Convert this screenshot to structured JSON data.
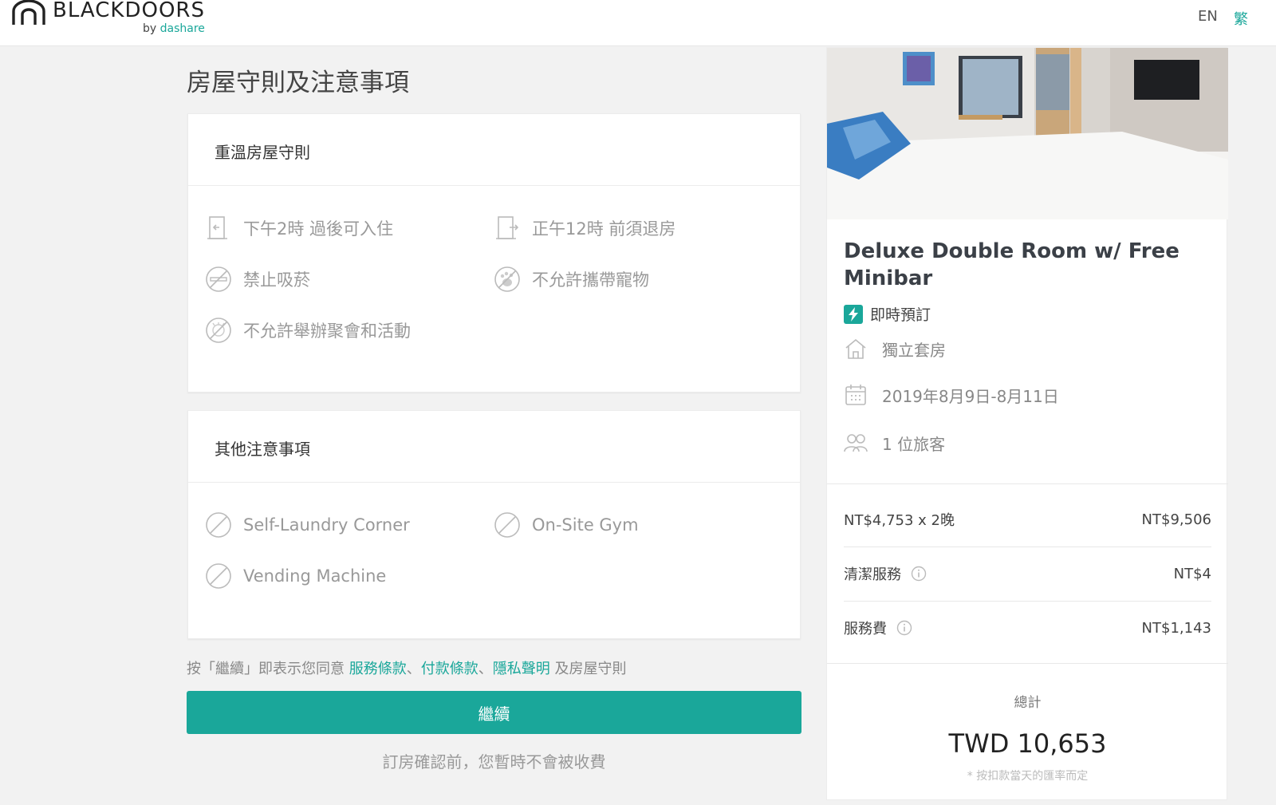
{
  "header": {
    "brand": "BLACKDOORS",
    "sub_by": "by ",
    "sub_brand": "dashare",
    "lang_en": "EN",
    "lang_zh": "繁"
  },
  "main": {
    "title": "房屋守則及注意事項",
    "rules_card": {
      "heading": "重溫房屋守則",
      "items": [
        "下午2時 過後可入住",
        "正午12時 前須退房",
        "禁止吸菸",
        "不允許攜帶寵物",
        "不允許舉辦聚會和活動"
      ]
    },
    "others_card": {
      "heading": "其他注意事項",
      "items": [
        "Self-Laundry Corner",
        "On-Site Gym",
        "Vending Machine"
      ]
    },
    "terms": {
      "prefix": "按「繼續」即表示您同意 ",
      "link_service": "服務條款",
      "sep1": "、",
      "link_payment": "付款條款",
      "sep2": "、",
      "link_privacy": "隱私聲明",
      "suffix": " 及房屋守則"
    },
    "continue_label": "繼續",
    "note": "訂房確認前，您暫時不會被收費"
  },
  "summary": {
    "room_title": "Deluxe Double Room w/ Free Minibar",
    "instant_booking": "即時預訂",
    "room_type": "獨立套房",
    "dates": "2019年8月9日-8月11日",
    "guests": "1 位旅客",
    "price_rows": [
      {
        "label": "NT$4,753 x 2晚",
        "value": "NT$9,506"
      },
      {
        "label": "清潔服務",
        "value": "NT$4"
      },
      {
        "label": "服務費",
        "value": "NT$1,143"
      }
    ],
    "total_label": "總計",
    "total_value": "TWD 10,653",
    "total_note": "* 按扣款當天的匯率而定"
  },
  "colors": {
    "accent": "#1aa79a",
    "background": "#f2f2f2"
  }
}
